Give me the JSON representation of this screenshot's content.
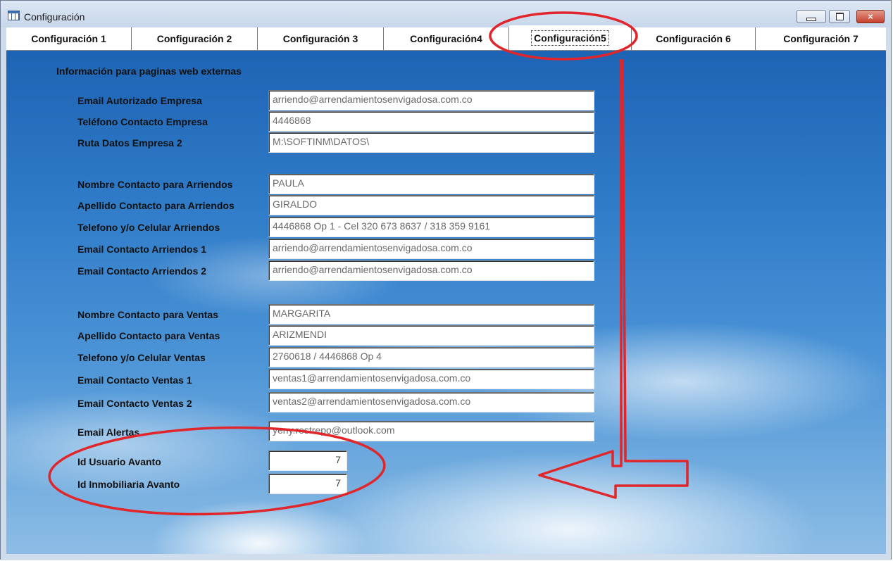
{
  "window": {
    "title": "Configuración",
    "icon": "table-icon",
    "controls": {
      "minimize": "minimize-icon",
      "maximize": "maximize-icon",
      "close": "×"
    }
  },
  "tabs": [
    {
      "label": "Configuración 1",
      "active": false
    },
    {
      "label": "Configuración 2",
      "active": false
    },
    {
      "label": "Configuración 3",
      "active": false
    },
    {
      "label": "Configuración4",
      "active": false
    },
    {
      "label": "Configuración5",
      "active": true
    },
    {
      "label": "Configuración 6",
      "active": false
    },
    {
      "label": "Configuración 7",
      "active": false
    }
  ],
  "section_title": "Información para paginas web externas",
  "fields": {
    "email_autorizado_empresa": {
      "label": "Email Autorizado Empresa",
      "value": "arriendo@arrendamientosenvigadosa.com.co"
    },
    "telefono_contacto_empresa": {
      "label": "Teléfono Contacto Empresa",
      "value": "4446868"
    },
    "ruta_datos_empresa_2": {
      "label": "Ruta Datos Empresa 2",
      "value": "M:\\SOFTINM\\DATOS\\"
    },
    "nombre_contacto_arriendos": {
      "label": "Nombre Contacto para Arriendos",
      "value": "PAULA"
    },
    "apellido_contacto_arriendos": {
      "label": "Apellido Contacto para Arriendos",
      "value": "GIRALDO"
    },
    "telefono_celular_arriendos": {
      "label": "Telefono y/o Celular Arriendos",
      "value": "4446868 Op 1 - Cel 320 673 8637 / 318 359 9161"
    },
    "email_contacto_arriendos_1": {
      "label": "Email Contacto Arriendos 1",
      "value": "arriendo@arrendamientosenvigadosa.com.co"
    },
    "email_contacto_arriendos_2": {
      "label": "Email Contacto Arriendos 2",
      "value": "arriendo@arrendamientosenvigadosa.com.co"
    },
    "nombre_contacto_ventas": {
      "label": "Nombre Contacto para Ventas",
      "value": "MARGARITA"
    },
    "apellido_contacto_ventas": {
      "label": "Apellido Contacto para Ventas",
      "value": "ARIZMENDI"
    },
    "telefono_celular_ventas": {
      "label": "Telefono y/o Celular Ventas",
      "value": "2760618 / 4446868 Op 4"
    },
    "email_contacto_ventas_1": {
      "label": "Email Contacto Ventas 1",
      "value": "ventas1@arrendamientosenvigadosa.com.co"
    },
    "email_contacto_ventas_2": {
      "label": "Email Contacto Ventas 2",
      "value": "ventas2@arrendamientosenvigadosa.com.co"
    },
    "email_alertas": {
      "label": "Email Alertas",
      "value": "yeny.restrepo@outlook.com"
    },
    "id_usuario_avanto": {
      "label": "Id Usuario Avanto",
      "value": "7"
    },
    "id_inmobiliaria_avanto": {
      "label": "Id Inmobiliaria Avanto",
      "value": "7"
    }
  },
  "colors": {
    "annotation": "#e0262a",
    "sky": "#2f7bc8"
  }
}
